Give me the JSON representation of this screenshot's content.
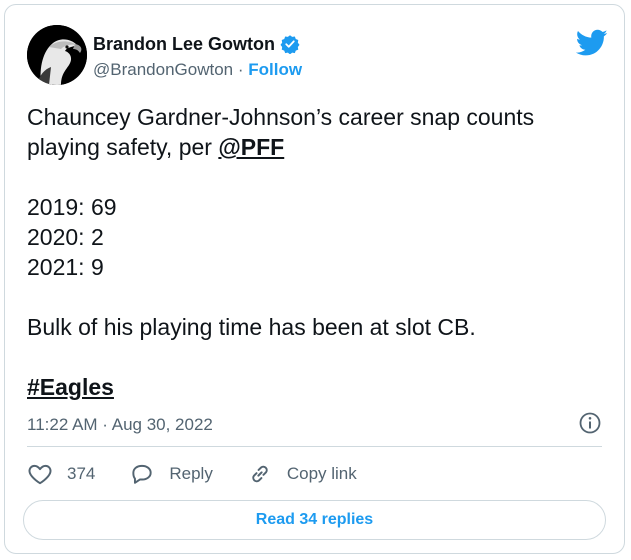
{
  "tweet": {
    "author": {
      "name": "Brandon Lee Gowton",
      "handle": "@BrandonGowton",
      "separator": "·",
      "follow_label": "Follow"
    },
    "body": {
      "line1_prefix": "Chauncey Gardner-Johnson’s career snap counts playing safety, per ",
      "mention": "@PFF",
      "stats": [
        "2019: 69",
        "2020: 2",
        "2021: 9"
      ],
      "summary": "Bulk of his playing time has been at slot CB.",
      "hashtag": "#Eagles"
    },
    "timestamp": "11:22 AM · Aug 30, 2022",
    "actions": {
      "like_count": "374",
      "reply_label": "Reply",
      "copy_link_label": "Copy link"
    },
    "read_replies_label": "Read 34 replies"
  },
  "colors": {
    "accent": "#1d9bf0",
    "secondary_text": "#536471",
    "border": "#cfd9de"
  },
  "icons": [
    "eagle-avatar",
    "verified-badge-icon",
    "twitter-bird-icon",
    "info-icon",
    "heart-icon",
    "reply-bubble-icon",
    "link-icon"
  ]
}
